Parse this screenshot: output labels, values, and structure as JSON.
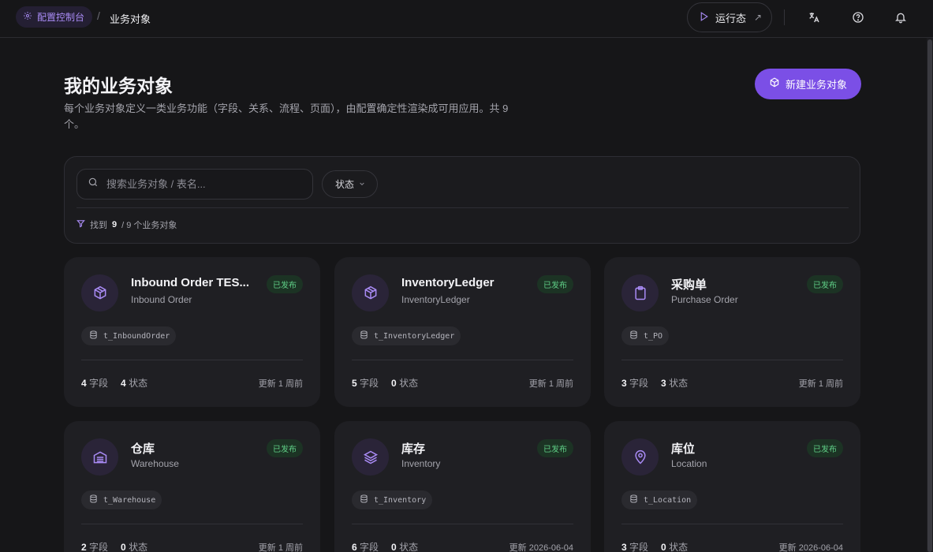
{
  "topbar": {
    "home_label": "配置控制台",
    "separator": "/",
    "current_label": "业务对象",
    "run_label": "运行态",
    "run_arrow": "↗"
  },
  "header": {
    "title": "我的业务对象",
    "description": "每个业务对象定义一类业务功能（字段、关系、流程、页面），由配置确定性渲染成可用应用。共 9 个。",
    "new_button": "新建业务对象"
  },
  "filter": {
    "search_placeholder": "搜索业务对象 / 表名...",
    "status_label": "状态",
    "found_prefix": "找到",
    "found_count": "9",
    "found_suffix": "/ 9 个业务对象"
  },
  "labels": {
    "fields": "字段",
    "states": "状态"
  },
  "cards": [
    {
      "title": "Inbound Order TES...",
      "subtitle": "Inbound Order",
      "badge": "已发布",
      "table": "t_InboundOrder",
      "fields": "4",
      "states": "4",
      "updated": "更新 1 周前",
      "icon": "cube-icon"
    },
    {
      "title": "InventoryLedger",
      "subtitle": "InventoryLedger",
      "badge": "已发布",
      "table": "t_InventoryLedger",
      "fields": "5",
      "states": "0",
      "updated": "更新 1 周前",
      "icon": "cube-icon"
    },
    {
      "title": "采购单",
      "subtitle": "Purchase Order",
      "badge": "已发布",
      "table": "t_PO",
      "fields": "3",
      "states": "3",
      "updated": "更新 1 周前",
      "icon": "clipboard-icon"
    },
    {
      "title": "仓库",
      "subtitle": "Warehouse",
      "badge": "已发布",
      "table": "t_Warehouse",
      "fields": "2",
      "states": "0",
      "updated": "更新 1 周前",
      "icon": "warehouse-icon"
    },
    {
      "title": "库存",
      "subtitle": "Inventory",
      "badge": "已发布",
      "table": "t_Inventory",
      "fields": "6",
      "states": "0",
      "updated": "更新 2026-06-04",
      "icon": "layers-icon"
    },
    {
      "title": "库位",
      "subtitle": "Location",
      "badge": "已发布",
      "table": "t_Location",
      "fields": "3",
      "states": "0",
      "updated": "更新 2026-06-04",
      "icon": "map-pin-icon"
    }
  ]
}
